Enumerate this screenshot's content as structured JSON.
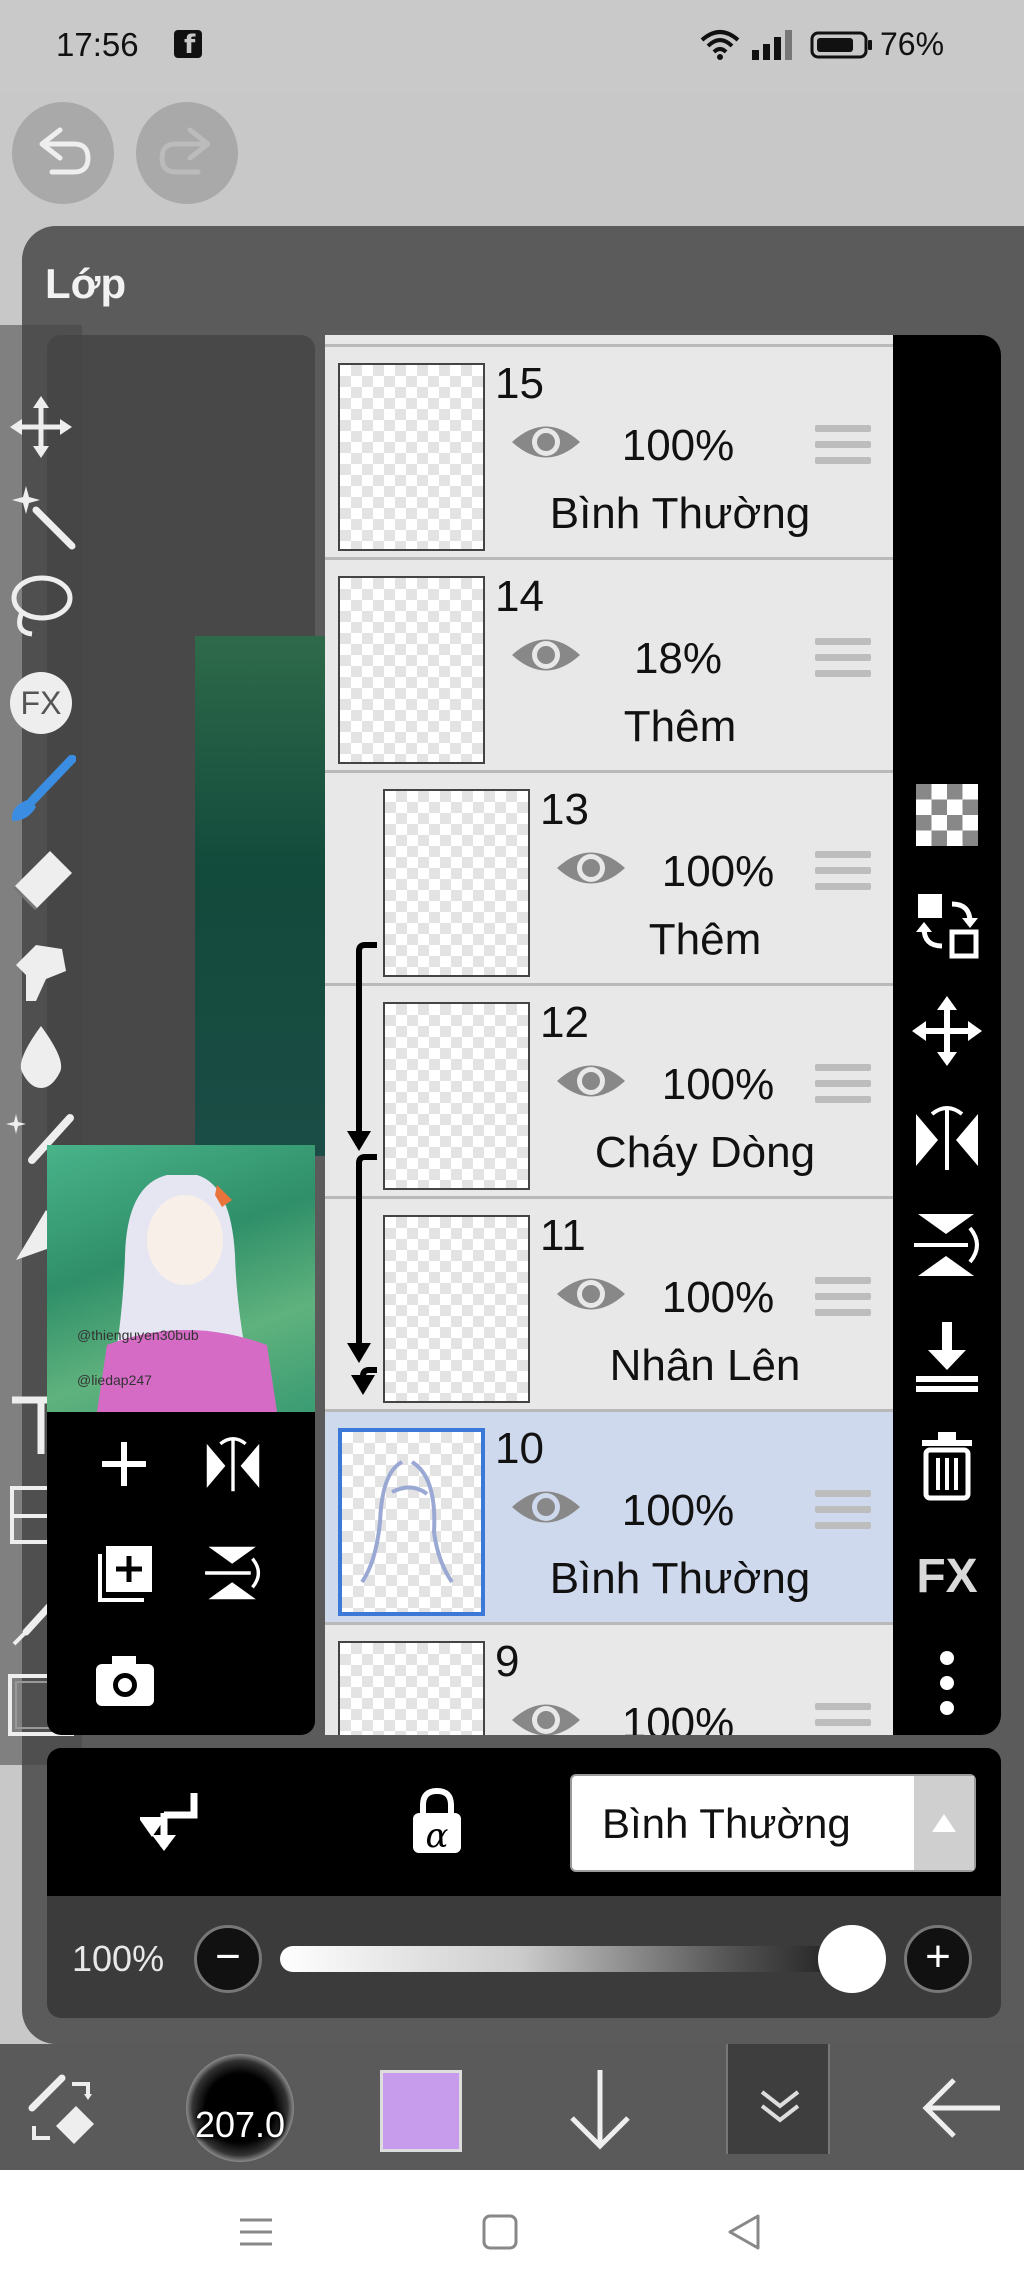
{
  "status_bar": {
    "time": "17:56",
    "battery_percent": "76%",
    "icons": [
      "facebook-icon",
      "wifi-icon",
      "signal-icon",
      "battery-icon"
    ]
  },
  "history": {
    "undo_icon": "undo-icon",
    "redo_icon": "redo-icon"
  },
  "panel": {
    "title": "Lớp"
  },
  "layers": [
    {
      "number": "15",
      "opacity": "100%",
      "blend": "Bình Thường",
      "visible": true,
      "clipped": false,
      "selected": false
    },
    {
      "number": "14",
      "opacity": "18%",
      "blend": "Thêm",
      "visible": true,
      "clipped": false,
      "selected": false
    },
    {
      "number": "13",
      "opacity": "100%",
      "blend": "Thêm",
      "visible": true,
      "clipped": true,
      "selected": false
    },
    {
      "number": "12",
      "opacity": "100%",
      "blend": "Cháy Dòng",
      "visible": true,
      "clipped": true,
      "selected": false
    },
    {
      "number": "11",
      "opacity": "100%",
      "blend": "Nhân Lên",
      "visible": true,
      "clipped": true,
      "selected": false
    },
    {
      "number": "10",
      "opacity": "100%",
      "blend": "Bình Thường",
      "visible": true,
      "clipped": false,
      "selected": true
    },
    {
      "number": "9",
      "opacity": "100%",
      "blend": "",
      "visible": true,
      "clipped": false,
      "selected": false
    }
  ],
  "right_tools": [
    "transparency-icon",
    "swap-layer-icon",
    "move-icon",
    "flip-horizontal-icon",
    "flip-vertical-icon",
    "merge-down-icon",
    "delete-icon",
    "fx-text",
    "more-icon"
  ],
  "right_tools_fx_label": "FX",
  "left_tools_fx_label": "FX",
  "preview": {
    "watermark_1": "@thienguyen30bub",
    "watermark_2": "@liedap247"
  },
  "controls": {
    "blend_mode": "Bình Thường",
    "opacity_value": "100%",
    "opacity_level": 1.0,
    "minus_label": "−",
    "plus_label": "+"
  },
  "bottom_bar": {
    "brush_size": "207.0",
    "color": "#c79cec"
  },
  "colors": {
    "panel": "#5b5b5b",
    "selected_layer": "#cfd9ee",
    "accent": "#3c78d8"
  }
}
